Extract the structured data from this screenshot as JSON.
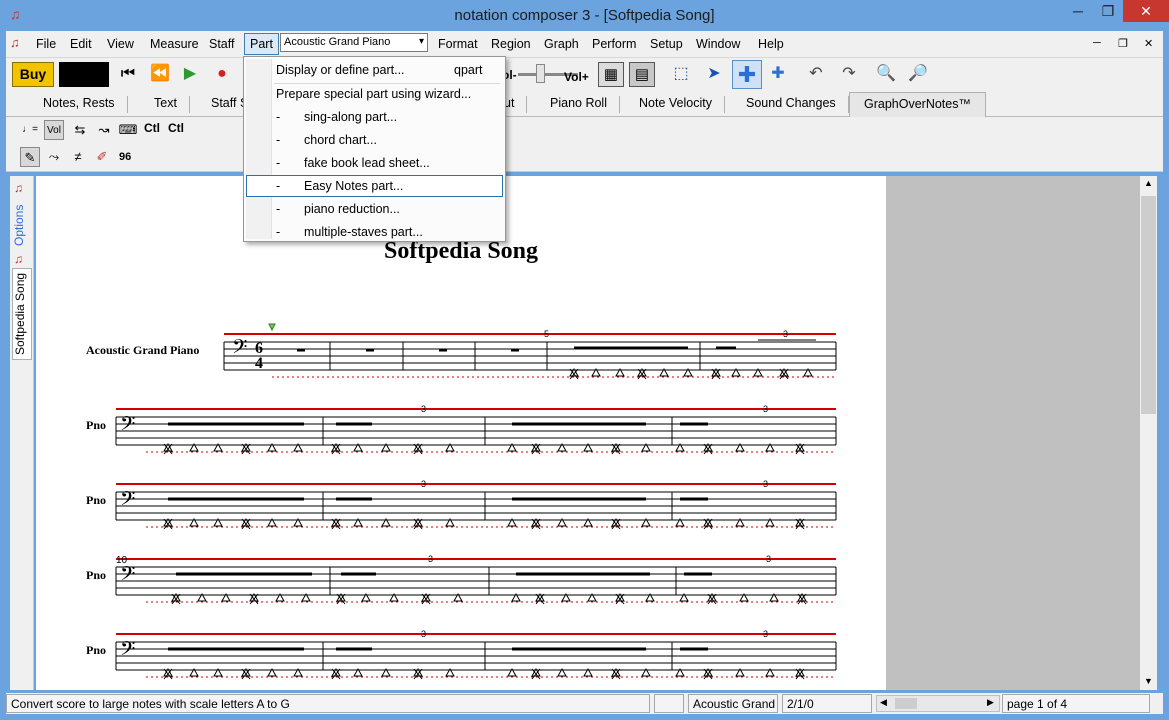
{
  "window": {
    "title": "notation composer 3 - [Softpedia Song]",
    "minimize": "─",
    "restore": "❐",
    "close": "✕"
  },
  "menu": {
    "items": [
      "File",
      "Edit",
      "View",
      "Measure",
      "Staff",
      "Part",
      "Format",
      "Region",
      "Graph",
      "Perform",
      "Setup",
      "Window",
      "Help"
    ],
    "part_select_value": "Acoustic Grand Piano",
    "mdi_buttons": [
      "─",
      "❐",
      "✕"
    ]
  },
  "toolbar": {
    "buy_label": "Buy",
    "vol_label": "Vol+",
    "vol_minus_label": "ol-"
  },
  "tabs": [
    "Notes,  Rests",
    "Text",
    "Staff S",
    "ut",
    "Piano Roll",
    "Note Velocity",
    "Sound Changes",
    "GraphOverNotes™"
  ],
  "toolbar2": {
    "ctl1": "Ctl",
    "ctl2": "Ctl"
  },
  "toolbar3": {
    "tempo_value": "96"
  },
  "sidebar": {
    "tab_options": "Options",
    "tab_song": "Softpedia Song"
  },
  "dropdown": {
    "items": [
      {
        "label": "Display or define part...",
        "accel": "qpart",
        "dash": ""
      },
      {
        "label": "Prepare special part using wizard...",
        "accel": "",
        "dash": ""
      },
      {
        "label": "sing-along part...",
        "accel": "",
        "dash": "-"
      },
      {
        "label": "chord chart...",
        "accel": "",
        "dash": "-"
      },
      {
        "label": "fake book lead sheet...",
        "accel": "",
        "dash": "-"
      },
      {
        "label": "Easy Notes part...",
        "accel": "",
        "dash": "-"
      },
      {
        "label": "piano reduction...",
        "accel": "",
        "dash": "-"
      },
      {
        "label": "multiple-staves part...",
        "accel": "",
        "dash": "-"
      }
    ]
  },
  "score": {
    "title": "Softpedia Song",
    "first_staff_label": "Acoustic Grand Piano",
    "other_staff_label": "Pno",
    "time_sig_top": "6",
    "time_sig_bottom": "4",
    "measure_number_5": "5",
    "measure_number_10": "10",
    "triplet": "3"
  },
  "status": {
    "message": "Convert score to large notes with scale letters A to G",
    "instrument": "Acoustic Grand",
    "position": "2/1/0",
    "page": "page 1 of 4"
  },
  "colors": {
    "accent": "#6aa3dd",
    "buy": "#f2c400",
    "staff_red": "#d00000"
  }
}
